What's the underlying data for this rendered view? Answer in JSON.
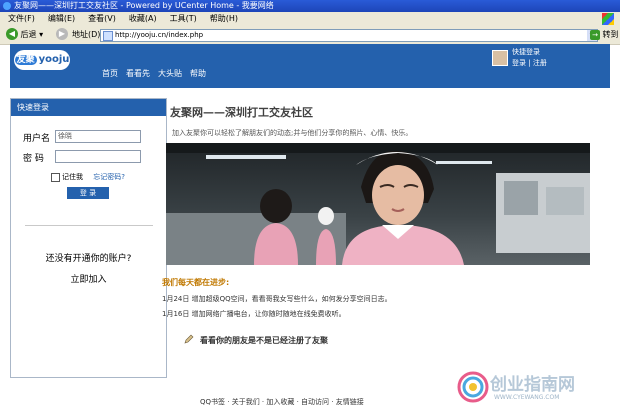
{
  "browser": {
    "title": "友聚网——深圳打工交友社区 - Powered by UCenter Home - 我要网络",
    "menu": [
      "文件(F)",
      "编辑(E)",
      "查看(V)",
      "收藏(A)",
      "工具(T)",
      "帮助(H)"
    ],
    "back_label": "后退",
    "address_label": "地址(D)",
    "url": "http://yooju.cn/index.php",
    "go_label": "转到"
  },
  "site": {
    "logo_cn": "友聚",
    "logo_en": "yooju",
    "nav": [
      "首页",
      "看看先",
      "大头贴",
      "帮助"
    ],
    "quick_login_link": "快捷登录",
    "login_link": "登录",
    "register_link": "注册",
    "login_register_sep": "|"
  },
  "sidebar": {
    "header": "快速登录",
    "username_label": "用户名",
    "username_value": "徐晓",
    "password_label": "密 码",
    "remember_label": "记住我",
    "forgot_label": "忘记密码?",
    "login_button": "登 录",
    "no_account_text": "还没有开通你的账户?",
    "register_now": "立即加入"
  },
  "main": {
    "title": "友聚网——深圳打工交友社区",
    "description": "加入友聚你可以轻松了解朋友们的动态;并与他们分享你的照片、心情、快乐。",
    "news_header": "我们每天都在进步:",
    "news": [
      "1月24日 增加超级QQ空间，看看哥我女写些什么，如何发分享空间日志。",
      "1月16日 增加网络广播电台，让你随时随地在线免费收听。"
    ],
    "invite": "看看你的朋友是不是已经注册了友聚"
  },
  "footer": {
    "links": "QQ书签 · 关于我们 · 加入收藏 · 自动访问 · 友情链接"
  },
  "watermark": {
    "text": "创业指南网",
    "url": "WWW.CYEWANG.COM"
  }
}
